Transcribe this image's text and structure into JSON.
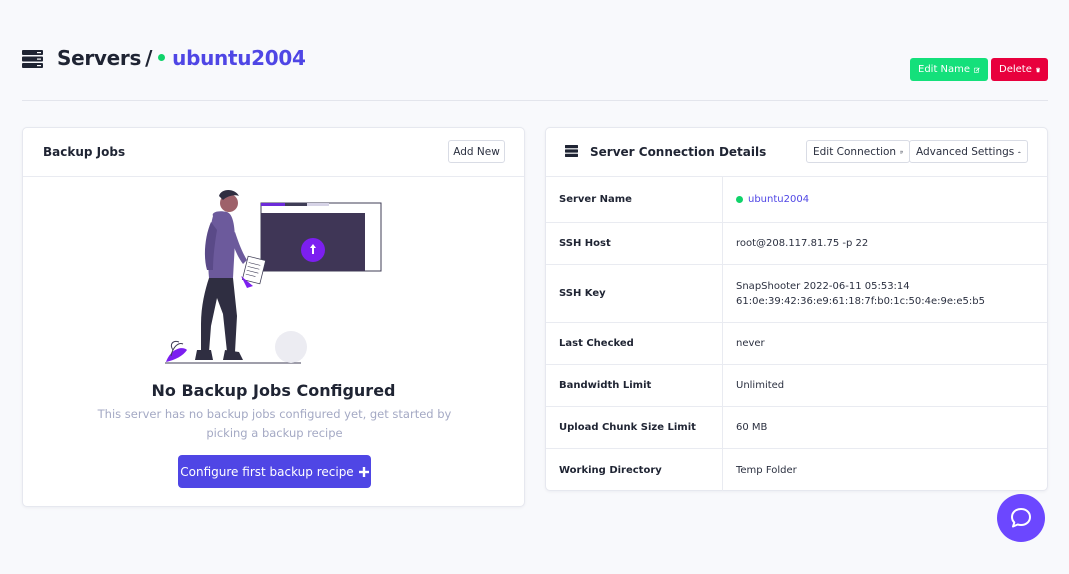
{
  "header": {
    "breadcrumb_root": "Servers",
    "separator": "/",
    "server_name": "ubuntu2004",
    "edit_name_label": "Edit Name",
    "delete_label": "Delete"
  },
  "backup_jobs": {
    "title": "Backup Jobs",
    "add_new_label": "Add New",
    "empty_title": "No Backup Jobs Configured",
    "empty_description": "This server has no backup jobs configured yet, get started by picking a backup recipe",
    "cta_label": "Configure first backup recipe"
  },
  "connection": {
    "title": "Server Connection Details",
    "edit_connection_label": "Edit Connection",
    "advanced_settings_label": "Advanced Settings",
    "rows": [
      {
        "label": "Server Name",
        "value": "ubuntu2004"
      },
      {
        "label": "SSH Host",
        "value": "root@208.117.81.75 -p 22"
      },
      {
        "label": "SSH Key",
        "value": "SnapShooter 2022-06-11 05:53:14",
        "value2": "61:0e:39:42:36:e9:61:18:7f:b0:1c:50:4e:9e:e5:b5"
      },
      {
        "label": "Last Checked",
        "value": "never"
      },
      {
        "label": "Bandwidth Limit",
        "value": "Unlimited"
      },
      {
        "label": "Upload Chunk Size Limit",
        "value": "60 MB"
      },
      {
        "label": "Working Directory",
        "value": "Temp Folder"
      }
    ]
  },
  "colors": {
    "accent": "#4f46e5",
    "status_online": "#10d36a",
    "edit_green": "#14e07b",
    "delete_red": "#e8003d",
    "chat_purple": "#6c47ff"
  },
  "icons": {
    "header": "server-stack-icon",
    "edit": "edit-icon",
    "delete": "trash-icon",
    "plus": "plus-icon",
    "dashboard": "speedometer-icon",
    "chat": "chat-bubble-icon"
  }
}
